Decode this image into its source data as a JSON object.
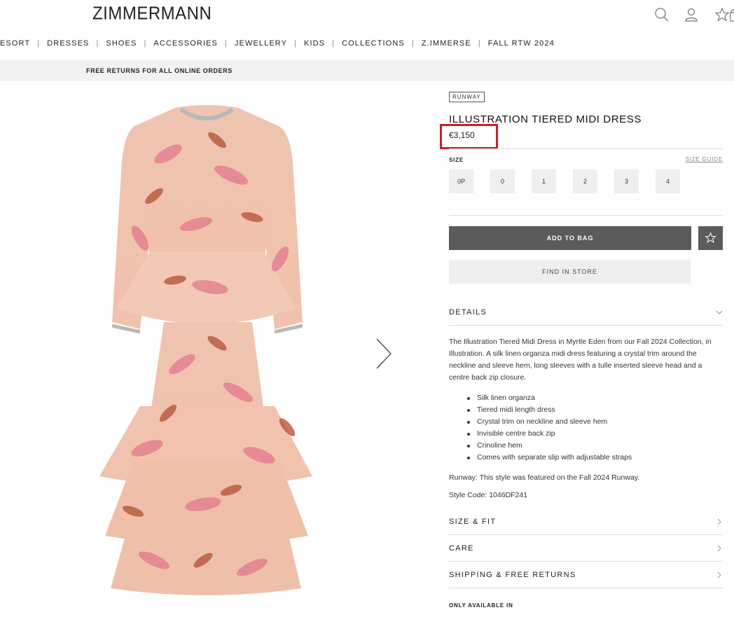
{
  "header": {
    "logo": "ZIMMERMANN",
    "icons": [
      "search-icon",
      "account-icon",
      "wishlist-icon",
      "bag-icon"
    ]
  },
  "nav": {
    "items": [
      "ESORT",
      "DRESSES",
      "SHOES",
      "ACCESSORIES",
      "JEWELLERY",
      "KIDS",
      "COLLECTIONS",
      "Z.IMMERSE",
      "FALL RTW 2024"
    ],
    "separator": "|"
  },
  "promo": {
    "text": "FREE RETURNS FOR ALL ONLINE ORDERS"
  },
  "product": {
    "badge": "RUNWAY",
    "title": "ILLUSTRATION TIERED MIDI DRESS",
    "price": "€3,150",
    "highlight_color": "#c8202a",
    "image_icon": "dress-image"
  },
  "sizes": {
    "label": "SIZE",
    "guide": "SIZE GUIDE",
    "options": [
      "0P",
      "0",
      "1",
      "2",
      "3",
      "4"
    ]
  },
  "actions": {
    "add_to_bag": "ADD TO BAG",
    "wishlist_icon": "star-icon",
    "find_in_store": "FIND IN STORE"
  },
  "details": {
    "heading": "DETAILS",
    "description": "The Illustration Tiered Midi Dress in Myrtle Eden from our Fall 2024 Collection, in Illustration. A silk linen organza midi dress featuring a crystal trim around the neckline and sleeve hem, long sleeves with a tulle inserted sleeve head and a centre back zip closure.",
    "bullets": [
      "Silk linen organza",
      "Tiered midi length dress",
      "Crystal trim on neckline and sleeve hem",
      "Invisible centre back zip",
      "Crinoline hem",
      "Comes with separate slip with adjustable straps"
    ],
    "runway_note": "Runway: This style was featured on the Fall 2024 Runway.",
    "style_code": "Style Code: 1046DF241"
  },
  "sections": {
    "size_fit": "SIZE & FIT",
    "care": "CARE",
    "shipping": "SHIPPING & FREE RETURNS"
  },
  "availability": {
    "label": "ONLY AVAILABLE IN"
  }
}
